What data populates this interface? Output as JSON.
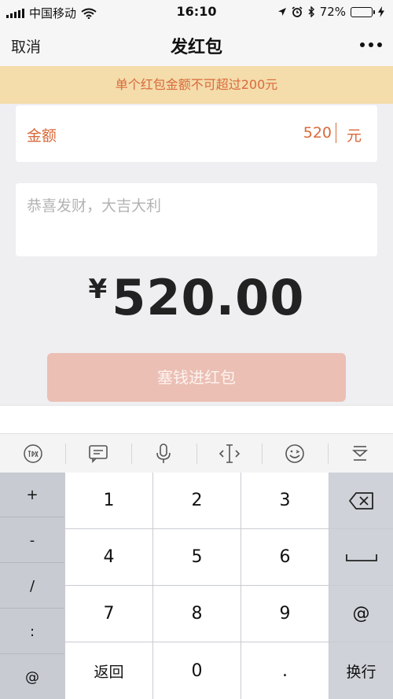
{
  "status": {
    "carrier": "中国移动",
    "time": "16:10",
    "battery": "72%",
    "battery_level": 0.72
  },
  "nav": {
    "cancel": "取消",
    "title": "发红包"
  },
  "notice": "单个红包金额不可超过200元",
  "amount": {
    "label": "金额",
    "value": "520",
    "unit": "元"
  },
  "message": {
    "placeholder": "恭喜发财，大吉大利"
  },
  "total": {
    "currency": "¥",
    "value": "520.00"
  },
  "submit": "塞钱进红包",
  "keyboard": {
    "side_keys": [
      "+",
      "-",
      "/",
      ":",
      "@"
    ],
    "digits": [
      "1",
      "2",
      "3",
      "4",
      "5",
      "6",
      "7",
      "8",
      "9"
    ],
    "back": "返回",
    "zero": "0",
    "dot": ".",
    "at": "@",
    "enter": "换行"
  },
  "colors": {
    "accent": "#d96a3a",
    "notice_bg": "#f4dcab",
    "submit_bg": "#ebbfb4"
  }
}
